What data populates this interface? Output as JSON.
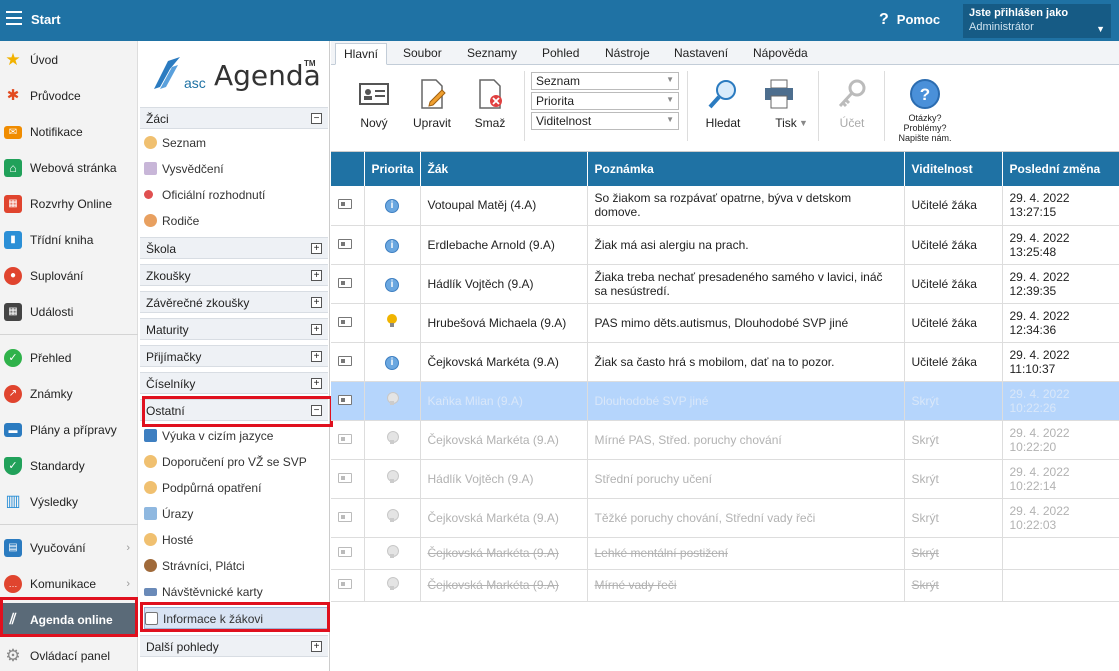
{
  "topbar": {
    "title": "Start",
    "help": "Pomoc",
    "user_line1": "Jste přihlášen jako",
    "user_line2": "Administrátor"
  },
  "leftnav": {
    "items": [
      {
        "label": "Úvod",
        "icon": "star-icon",
        "color": "#f2b200"
      },
      {
        "label": "Průvodce",
        "icon": "wand-icon",
        "color": "#e24a1f"
      },
      {
        "label": "Notifikace",
        "icon": "envelope-icon",
        "color": "#f08c00"
      },
      {
        "label": "Webová stránka",
        "icon": "home-icon",
        "color": "#21a15a"
      },
      {
        "label": "Rozvrhy Online",
        "icon": "timetable-icon",
        "color": "#e0442e"
      },
      {
        "label": "Třídní kniha",
        "icon": "book-icon",
        "color": "#2b8fd6"
      },
      {
        "label": "Suplování",
        "icon": "substitute-icon",
        "color": "#e0442e"
      },
      {
        "label": "Události",
        "icon": "calendar-icon",
        "color": "#444444"
      },
      {
        "label": "Přehled",
        "icon": "check-icon",
        "color": "#2fb24a"
      },
      {
        "label": "Známky",
        "icon": "grades-icon",
        "color": "#e0442e"
      },
      {
        "label": "Plány a přípravy",
        "icon": "briefcase-icon",
        "color": "#2b7bc0"
      },
      {
        "label": "Standardy",
        "icon": "shield-icon",
        "color": "#21a15a"
      },
      {
        "label": "Výsledky",
        "icon": "bar-chart-icon",
        "color": "#2b8fd6"
      },
      {
        "label": "Vyučování",
        "icon": "teaching-icon",
        "color": "#2b7bc0"
      },
      {
        "label": "Komunikace",
        "icon": "chat-icon",
        "color": "#e0442e"
      },
      {
        "label": "Agenda online",
        "icon": "agenda-icon",
        "color": "#ffffff"
      },
      {
        "label": "Ovládací panel",
        "icon": "gear-icon",
        "color": "#888888"
      }
    ]
  },
  "tree": {
    "logo_asc": "asc",
    "logo_agenda": "Agenda",
    "logo_tm": "TM",
    "groups": {
      "zaci": "Žáci",
      "skola": "Škola",
      "zkousky": "Zkoušky",
      "zaverecne": "Závěrečné zkoušky",
      "maturity": "Maturity",
      "prijimacky": "Přijímačky",
      "ciselniky": "Číselníky",
      "ostatni": "Ostatní",
      "dalsi": "Další pohledy"
    },
    "zaci_items": [
      "Seznam",
      "Vysvědčení",
      "Oficiální rozhodnutí",
      "Rodiče"
    ],
    "ostatni_items": [
      "Výuka v cizím jazyce",
      "Doporučení pro VŽ se SVP",
      "Podpůrná opatření",
      "Úrazy",
      "Hosté",
      "Strávníci, Plátci",
      "Návštěvnické karty",
      "Informace k žákovi"
    ]
  },
  "ribbon": {
    "tabs": [
      "Hlavní",
      "Soubor",
      "Seznamy",
      "Pohled",
      "Nástroje",
      "Nastavení",
      "Nápověda"
    ],
    "novy": "Nový",
    "upravit": "Upravit",
    "smaz": "Smaž",
    "combo1": "Seznam",
    "combo2": "Priorita",
    "combo3": "Viditelnost",
    "hledat": "Hledat",
    "tisk": "Tisk",
    "ucet": "Účet",
    "otazky": "Otázky?",
    "problemy": "Problémy?",
    "napiste": "Napište nám."
  },
  "grid": {
    "headers": [
      "Priorita",
      "Žák",
      "Poznámka",
      "Viditelnost",
      "Poslední změna"
    ],
    "rows": [
      {
        "priority": "info",
        "zak": "Votoupal Matěj (4.A)",
        "pozn": "So žiakom sa rozpávať opatrne, býva v detskom domove.",
        "vid": "Učitelé žáka",
        "date": "29. 4. 2022",
        "time": "13:27:15",
        "state": "normal"
      },
      {
        "priority": "info",
        "zak": "Erdlebache Arnold (9.A)",
        "pozn": "Žiak má asi alergiu na prach.",
        "vid": "Učitelé žáka",
        "date": "29. 4. 2022",
        "time": "13:25:48",
        "state": "normal"
      },
      {
        "priority": "info",
        "zak": "Hádlík Vojtěch (9.A)",
        "pozn": "Žiaka treba nechať presadeného samého v lavici, ináč sa nesústredí.",
        "vid": "Učitelé žáka",
        "date": "29. 4. 2022",
        "time": "12:39:35",
        "state": "normal"
      },
      {
        "priority": "bulb",
        "zak": "Hrubešová Michaela (9.A)",
        "pozn": "PAS mimo děts.autismus, Dlouhodobé SVP jiné",
        "vid": "Učitelé žáka",
        "date": "29. 4. 2022",
        "time": "12:34:36",
        "state": "normal"
      },
      {
        "priority": "info",
        "zak": "Čejkovská Markéta (9.A)",
        "pozn": "Žiak sa často hrá s mobilom, dať na to pozor.",
        "vid": "Učitelé žáka",
        "date": "29. 4. 2022",
        "time": "11:10:37",
        "state": "normal"
      },
      {
        "priority": "bulb-off",
        "zak": "Kaňka Milan (9.A)",
        "pozn": "Dlouhodobé SVP jiné",
        "vid": "Skrýt",
        "date": "29. 4. 2022",
        "time": "10:22:26",
        "state": "selected"
      },
      {
        "priority": "bulb-off",
        "zak": "Čejkovská Markéta (9.A)",
        "pozn": "Mírné PAS, Střed. poruchy chování",
        "vid": "Skrýt",
        "date": "29. 4. 2022",
        "time": "10:22:20",
        "state": "hidden"
      },
      {
        "priority": "bulb-off",
        "zak": "Hádlík Vojtěch (9.A)",
        "pozn": "Střední poruchy učení",
        "vid": "Skrýt",
        "date": "29. 4. 2022",
        "time": "10:22:14",
        "state": "hidden"
      },
      {
        "priority": "bulb-off",
        "zak": "Čejkovská Markéta (9.A)",
        "pozn": "Těžké poruchy chování, Střední vady řeči",
        "vid": "Skrýt",
        "date": "29. 4. 2022",
        "time": "10:22:03",
        "state": "hidden"
      },
      {
        "priority": "bulb-off",
        "zak": "Čejkovská Markéta (9.A)",
        "pozn": "Lehké mentální postižení",
        "vid": "Skrýt",
        "date": "",
        "time": "",
        "state": "strike"
      },
      {
        "priority": "bulb-off",
        "zak": "Čejkovská Markéta (9.A)",
        "pozn": "Mírné vady řeči",
        "vid": "Skrýt",
        "date": "",
        "time": "",
        "state": "strike"
      }
    ]
  }
}
